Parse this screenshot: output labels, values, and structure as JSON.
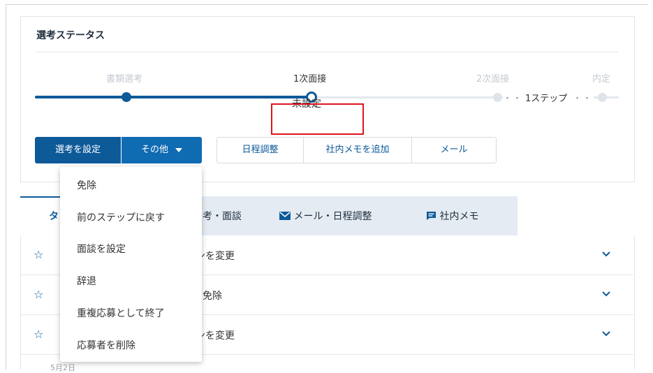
{
  "status_card": {
    "title": "選考ステータス",
    "stages": [
      "書類選考",
      "1次面接",
      "2次面接",
      "内定"
    ],
    "skip_label": "1ステップ",
    "skip_dots": "・・",
    "current_status": "未設定"
  },
  "buttons": {
    "set_selection": "選考を設定",
    "other": "その他",
    "schedule": "日程調整",
    "add_memo": "社内メモを追加",
    "mail": "メール"
  },
  "tabs": {
    "active": "タ",
    "selection": "考・面談",
    "mail": "メール・日程調整",
    "memo": "社内メモ"
  },
  "rows": [
    {
      "text": "ンを変更",
      "icon": "star-icon"
    },
    {
      "text": "免除",
      "icon": "star-icon"
    },
    {
      "text": "ンを変更",
      "icon": "star-icon"
    }
  ],
  "partial_date": "5月2日",
  "dropdown_items": [
    "免除",
    "前のステップに戻す",
    "面談を設定",
    "辞退",
    "重複応募として終了",
    "応募者を削除"
  ],
  "colors": {
    "primary": "#0d5a99",
    "highlight_box": "#e0141e"
  }
}
